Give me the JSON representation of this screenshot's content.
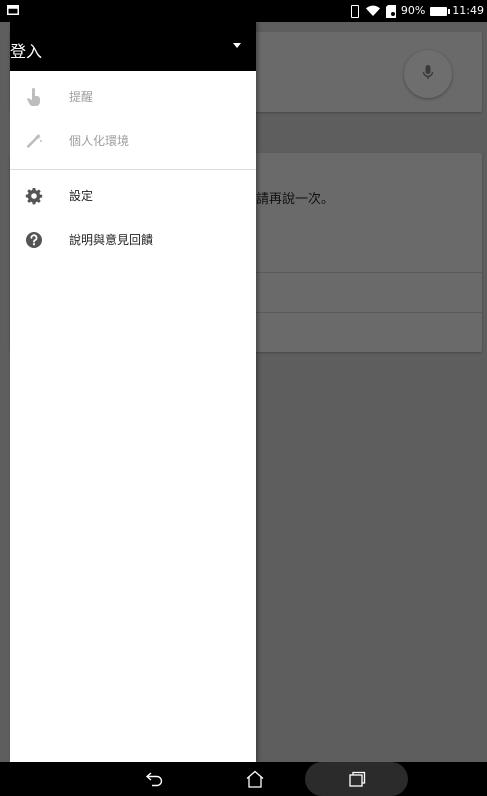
{
  "status_bar": {
    "left_icon": "screenshot-notification-icon",
    "icons": [
      "vibrate-icon",
      "wifi-icon",
      "sd-card-icon",
      "battery-icon"
    ],
    "battery": "90%",
    "time": "11:49"
  },
  "background": {
    "message": "請再說一次。",
    "mic_icon": "mic-icon"
  },
  "drawer": {
    "header_title": "登入",
    "items": [
      {
        "label": "提醒",
        "icon": "reminder-hand-icon",
        "enabled": false
      },
      {
        "label": "個人化環境",
        "icon": "magic-wand-icon",
        "enabled": false
      },
      {
        "label": "設定",
        "icon": "gear-icon",
        "enabled": true
      },
      {
        "label": "說明與意見回饋",
        "icon": "help-icon",
        "enabled": true
      }
    ]
  },
  "nav_bar": {
    "buttons": [
      "back-icon",
      "home-icon",
      "recent-apps-icon"
    ]
  },
  "colors": {
    "drawer_background": "#ffffff",
    "header_background": "#000000",
    "scrim": "#5e5e5e",
    "disabled_text": "#9e9e9e",
    "enabled_text": "#222222"
  }
}
